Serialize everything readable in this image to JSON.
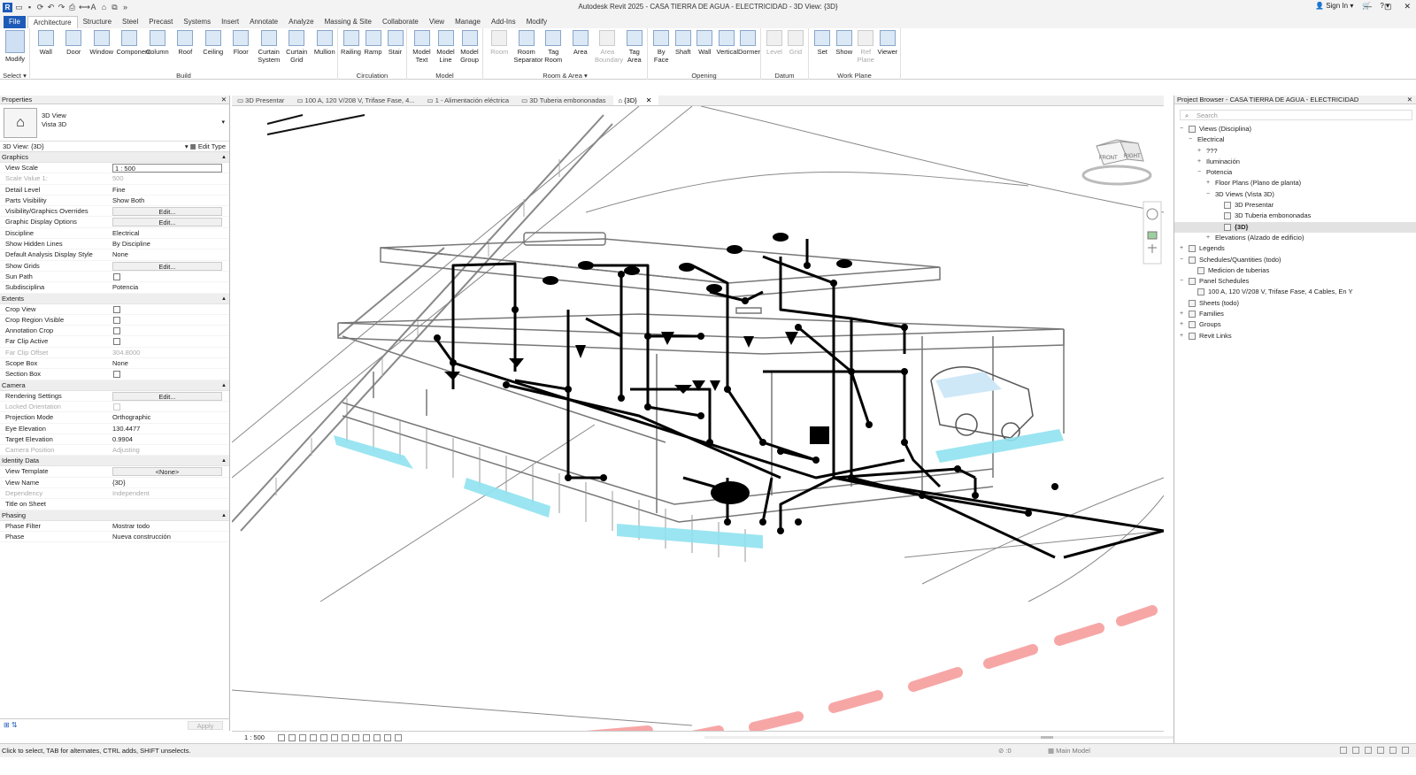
{
  "window": {
    "title": "Autodesk Revit 2025 - CASA TIERRA DE AGUA - ELECTRICIDAD - 3D View: {3D}",
    "sign_in": "Sign In"
  },
  "tabs": [
    "File",
    "Architecture",
    "Structure",
    "Steel",
    "Precast",
    "Systems",
    "Insert",
    "Annotate",
    "Analyze",
    "Massing & Site",
    "Collaborate",
    "View",
    "Manage",
    "Add-Ins",
    "Modify"
  ],
  "ribbon": {
    "select": {
      "modify": "Modify",
      "title": "Select ▾"
    },
    "build": {
      "title": "Build",
      "tools": [
        "Wall",
        "Door",
        "Window",
        "Component",
        "Column",
        "Roof",
        "Ceiling",
        "Floor",
        "Curtain System",
        "Curtain Grid",
        "Mullion"
      ]
    },
    "circulation": {
      "title": "Circulation",
      "tools": [
        "Railing",
        "Ramp",
        "Stair"
      ]
    },
    "model": {
      "title": "Model",
      "tools": [
        "Model Text",
        "Model Line",
        "Model Group"
      ]
    },
    "room_area": {
      "title": "Room & Area ▾",
      "tools": [
        "Room",
        "Room Separator",
        "Tag Room",
        "Area",
        "Area Boundary",
        "Tag Area"
      ]
    },
    "opening": {
      "title": "Opening",
      "tools": [
        "By Face",
        "Shaft",
        "Wall",
        "Vertical",
        "Dormer"
      ]
    },
    "datum": {
      "title": "Datum",
      "tools": [
        "Level",
        "Grid"
      ]
    },
    "work_plane": {
      "title": "Work Plane",
      "tools": [
        "Set",
        "Show",
        "Ref Plane",
        "Viewer"
      ]
    }
  },
  "properties": {
    "header": "Properties",
    "type_line1": "3D View",
    "type_line2": "Vista 3D",
    "instance": "3D View: {3D}",
    "edit_type": "Edit Type",
    "sections": [
      {
        "name": "Graphics",
        "rows": [
          {
            "k": "View Scale",
            "v": "1 : 500",
            "kind": "box"
          },
          {
            "k": "Scale Value    1:",
            "v": "500",
            "kind": "text",
            "dim": true
          },
          {
            "k": "Detail Level",
            "v": "Fine",
            "kind": "text"
          },
          {
            "k": "Parts Visibility",
            "v": "Show Both",
            "kind": "text"
          },
          {
            "k": "Visibility/Graphics Overrides",
            "v": "Edit...",
            "kind": "btn"
          },
          {
            "k": "Graphic Display Options",
            "v": "Edit...",
            "kind": "btn"
          },
          {
            "k": "Discipline",
            "v": "Electrical",
            "kind": "text"
          },
          {
            "k": "Show Hidden Lines",
            "v": "By Discipline",
            "kind": "text"
          },
          {
            "k": "Default Analysis Display Style",
            "v": "None",
            "kind": "text"
          },
          {
            "k": "Show Grids",
            "v": "Edit...",
            "kind": "btn"
          },
          {
            "k": "Sun Path",
            "v": "",
            "kind": "cb"
          },
          {
            "k": "Subdisciplina",
            "v": "Potencia",
            "kind": "text"
          }
        ]
      },
      {
        "name": "Extents",
        "rows": [
          {
            "k": "Crop View",
            "v": "",
            "kind": "cb"
          },
          {
            "k": "Crop Region Visible",
            "v": "",
            "kind": "cb"
          },
          {
            "k": "Annotation Crop",
            "v": "",
            "kind": "cb"
          },
          {
            "k": "Far Clip Active",
            "v": "",
            "kind": "cb"
          },
          {
            "k": "Far Clip Offset",
            "v": "304.8000",
            "kind": "text",
            "dim": true
          },
          {
            "k": "Scope Box",
            "v": "None",
            "kind": "text"
          },
          {
            "k": "Section Box",
            "v": "",
            "kind": "cb"
          }
        ]
      },
      {
        "name": "Camera",
        "rows": [
          {
            "k": "Rendering Settings",
            "v": "Edit...",
            "kind": "btn"
          },
          {
            "k": "Locked Orientation",
            "v": "",
            "kind": "cb",
            "dim": true
          },
          {
            "k": "Projection Mode",
            "v": "Orthographic",
            "kind": "text"
          },
          {
            "k": "Eye Elevation",
            "v": "130.4477",
            "kind": "text"
          },
          {
            "k": "Target Elevation",
            "v": "0.9904",
            "kind": "text"
          },
          {
            "k": "Camera Position",
            "v": "Adjusting",
            "kind": "text",
            "dim": true
          }
        ]
      },
      {
        "name": "Identity Data",
        "rows": [
          {
            "k": "View Template",
            "v": "<None>",
            "kind": "btn"
          },
          {
            "k": "View Name",
            "v": "{3D}",
            "kind": "text"
          },
          {
            "k": "Dependency",
            "v": "Independent",
            "kind": "text",
            "dim": true
          },
          {
            "k": "Title on Sheet",
            "v": "",
            "kind": "text"
          }
        ]
      },
      {
        "name": "Phasing",
        "rows": [
          {
            "k": "Phase Filter",
            "v": "Mostrar todo",
            "kind": "text"
          },
          {
            "k": "Phase",
            "v": "Nueva construcción",
            "kind": "text"
          }
        ]
      }
    ],
    "apply": "Apply"
  },
  "view_tabs": [
    {
      "label": "3D Presentar",
      "active": false
    },
    {
      "label": "100 A, 120 V/208 V, Trifase Fase, 4...",
      "active": false
    },
    {
      "label": "1 - Alimentación eléctrica",
      "active": false
    },
    {
      "label": "3D Tuberia embononadas",
      "active": false
    },
    {
      "label": "{3D}",
      "active": true
    }
  ],
  "viewcube": {
    "front": "FRONT",
    "right": "RIGHT"
  },
  "view_control": {
    "scale": "1 : 500"
  },
  "project_browser": {
    "header": "Project Browser - CASA TIERRA DE AGUA - ELECTRICIDAD",
    "search": "Search",
    "nodes": [
      {
        "label": "Views (Disciplina)",
        "lvl": 0,
        "ex": "−",
        "ico": true
      },
      {
        "label": "Electrical",
        "lvl": 1,
        "ex": "−",
        "ico": false
      },
      {
        "label": "???",
        "lvl": 2,
        "ex": "+",
        "ico": false
      },
      {
        "label": "Iluminación",
        "lvl": 2,
        "ex": "+",
        "ico": false
      },
      {
        "label": "Potencia",
        "lvl": 2,
        "ex": "−",
        "ico": false
      },
      {
        "label": "Floor Plans (Plano de planta)",
        "lvl": 3,
        "ex": "+",
        "ico": false
      },
      {
        "label": "3D Views (Vista 3D)",
        "lvl": 3,
        "ex": "−",
        "ico": false
      },
      {
        "label": "3D Presentar",
        "lvl": 4,
        "ex": "",
        "ico": true
      },
      {
        "label": "3D Tuberia embononadas",
        "lvl": 4,
        "ex": "",
        "ico": true
      },
      {
        "label": "{3D}",
        "lvl": 4,
        "ex": "",
        "ico": true,
        "sel": true
      },
      {
        "label": "Elevations (Alzado de edificio)",
        "lvl": 3,
        "ex": "+",
        "ico": false
      },
      {
        "label": "Legends",
        "lvl": 0,
        "ex": "+",
        "ico": true
      },
      {
        "label": "Schedules/Quantities (todo)",
        "lvl": 0,
        "ex": "−",
        "ico": true
      },
      {
        "label": "Medicion de tuberias",
        "lvl": 1,
        "ex": "",
        "ico": true
      },
      {
        "label": "Panel Schedules",
        "lvl": 0,
        "ex": "−",
        "ico": true
      },
      {
        "label": "100 A, 120 V/208 V, Trifase Fase, 4 Cables, En Y",
        "lvl": 1,
        "ex": "",
        "ico": true
      },
      {
        "label": "Sheets (todo)",
        "lvl": 0,
        "ex": "",
        "ico": true
      },
      {
        "label": "Families",
        "lvl": 0,
        "ex": "+",
        "ico": true
      },
      {
        "label": "Groups",
        "lvl": 0,
        "ex": "+",
        "ico": true
      },
      {
        "label": "Revit Links",
        "lvl": 0,
        "ex": "+",
        "ico": true
      }
    ]
  },
  "status": {
    "message": "Click to select, TAB for alternates, CTRL adds, SHIFT unselects.",
    "model": "Main Model",
    "zero": ":0"
  }
}
